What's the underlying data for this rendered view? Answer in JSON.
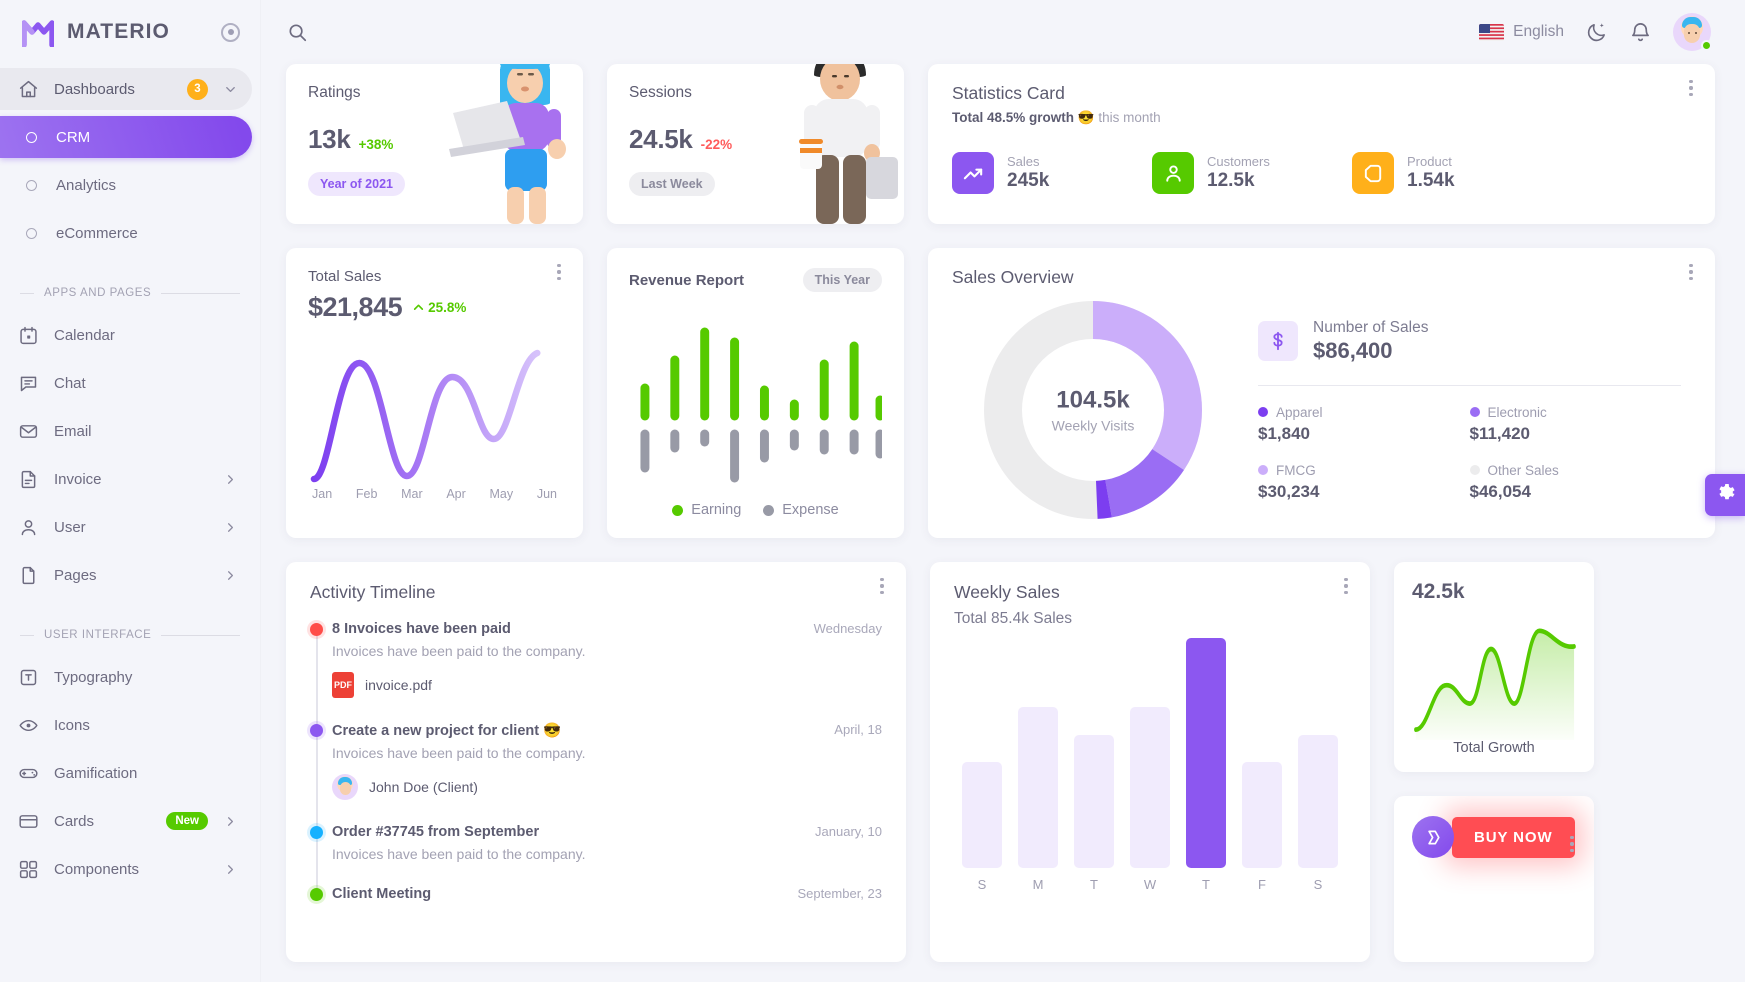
{
  "brand": {
    "name": "MATERIO",
    "logo_icon": "materio-logo-icon",
    "pin_icon": "pin-sidebar-icon"
  },
  "sidebar": {
    "group": {
      "label": "Dashboards",
      "badge": "3",
      "icon": "home-icon",
      "chevron": "chevron-down-icon"
    },
    "dashboards": [
      {
        "label": "CRM",
        "active": true
      },
      {
        "label": "Analytics",
        "active": false
      },
      {
        "label": "eCommerce",
        "active": false
      }
    ],
    "section_apps": "APPS AND PAGES",
    "apps": [
      {
        "label": "Calendar",
        "icon": "calendar-icon",
        "arrow": false,
        "badge": ""
      },
      {
        "label": "Chat",
        "icon": "chat-icon",
        "arrow": false,
        "badge": ""
      },
      {
        "label": "Email",
        "icon": "email-icon",
        "arrow": false,
        "badge": ""
      },
      {
        "label": "Invoice",
        "icon": "invoice-icon",
        "arrow": true,
        "badge": ""
      },
      {
        "label": "User",
        "icon": "user-icon",
        "arrow": true,
        "badge": ""
      },
      {
        "label": "Pages",
        "icon": "pages-icon",
        "arrow": true,
        "badge": ""
      }
    ],
    "section_ui": "USER INTERFACE",
    "ui": [
      {
        "label": "Typography",
        "icon": "typography-icon",
        "arrow": false,
        "badge": ""
      },
      {
        "label": "Icons",
        "icon": "eye-icon",
        "arrow": false,
        "badge": ""
      },
      {
        "label": "Gamification",
        "icon": "gamepad-icon",
        "arrow": false,
        "badge": ""
      },
      {
        "label": "Cards",
        "icon": "card-icon",
        "arrow": true,
        "badge": "New"
      },
      {
        "label": "Components",
        "icon": "components-icon",
        "arrow": true,
        "badge": ""
      }
    ]
  },
  "topbar": {
    "search_icon": "search-icon",
    "language": "English",
    "flag_icon": "us-flag-icon",
    "theme_icon": "moon-icon",
    "bell_icon": "bell-icon",
    "avatar_icon": "user-avatar"
  },
  "ratings": {
    "title": "Ratings",
    "value": "13k",
    "delta": "+38%",
    "chip": "Year of 2021",
    "art": "woman-with-laptop-illustration"
  },
  "sessions": {
    "title": "Sessions",
    "value": "24.5k",
    "delta": "-22%",
    "chip": "Last Week",
    "art": "man-with-coffee-illustration"
  },
  "statistics": {
    "title": "Statistics Card",
    "sub_strong": "Total 48.5% growth",
    "sub_emoji": "😎",
    "sub_rest": "this month",
    "items": [
      {
        "label": "Sales",
        "value": "245k",
        "color": "#8c57f0",
        "icon": "trending-up-icon"
      },
      {
        "label": "Customers",
        "value": "12.5k",
        "color": "#56ca00",
        "icon": "account-icon"
      },
      {
        "label": "Product",
        "value": "1.54k",
        "color": "#ffb01a",
        "icon": "tag-icon"
      }
    ]
  },
  "total_sales": {
    "title": "Total Sales",
    "value": "$21,845",
    "delta": "25.8%"
  },
  "revenue_report": {
    "title": "Revenue Report",
    "chip": "This Year",
    "legend": [
      {
        "label": "Earning",
        "color": "#56ca00"
      },
      {
        "label": "Expense",
        "color": "#989aa6"
      }
    ]
  },
  "sales_overview": {
    "title": "Sales Overview",
    "center_value": "104.5k",
    "center_caption": "Weekly Visits",
    "sales_label": "Number of Sales",
    "sales_value": "$86,400",
    "legend": [
      {
        "name": "Apparel",
        "value": "$1,840",
        "color": "#7c3ef0"
      },
      {
        "name": "Electronic",
        "value": "$11,420",
        "color": "#9a6df4"
      },
      {
        "name": "FMCG",
        "value": "$30,234",
        "color": "#cbaefa"
      },
      {
        "name": "Other Sales",
        "value": "$46,054",
        "color": "#ececed"
      }
    ]
  },
  "activity_timeline": {
    "title": "Activity Timeline",
    "items": [
      {
        "name": "8 Invoices have been paid",
        "date": "Wednesday",
        "desc": "Invoices have been paid to the company.",
        "color": "#ff4d49",
        "attachment": "invoice.pdf",
        "attachment_type": "pdf",
        "pdf_label": "PDF"
      },
      {
        "name": "Create a new project for client 😎",
        "date": "April, 18",
        "desc": "Invoices have been paid to the company.",
        "color": "#8c57f0",
        "attachment": "John Doe (Client)",
        "attachment_type": "avatar"
      },
      {
        "name": "Order #37745 from September",
        "date": "January, 10",
        "desc": "Invoices have been paid to the company.",
        "color": "#16b1ff",
        "attachment": "",
        "attachment_type": "none"
      },
      {
        "name": "Client Meeting",
        "date": "September, 23",
        "desc": "",
        "color": "#56ca00",
        "attachment": "",
        "attachment_type": "none"
      }
    ]
  },
  "weekly_sales": {
    "title": "Weekly Sales",
    "subtitle": "Total 85.4k Sales"
  },
  "total_growth": {
    "value": "42.5k",
    "caption": "Total Growth"
  },
  "promo": {
    "buy_now": "BUY NOW",
    "logo_icon": "themeselection-logo-icon"
  },
  "settings_tab": {
    "icon": "gear-icon"
  },
  "chart_data": [
    {
      "type": "line",
      "name": "total-sales-trend",
      "title": "Total Sales",
      "categories": [
        "Jan",
        "Feb",
        "Mar",
        "Apr",
        "May",
        "Jun"
      ],
      "values": [
        8,
        86,
        14,
        72,
        42,
        96
      ],
      "ylim": [
        0,
        100
      ],
      "grid": false,
      "legend": "none",
      "colors": [
        "#8c57f0"
      ]
    },
    {
      "type": "bar",
      "name": "revenue-report",
      "title": "Revenue Report",
      "categories": [
        "1",
        "2",
        "3",
        "4",
        "5",
        "6",
        "7",
        "8",
        "9"
      ],
      "series": [
        {
          "name": "Earning",
          "color": "#56ca00",
          "values": [
            28,
            48,
            72,
            64,
            24,
            12,
            44,
            60,
            16
          ]
        },
        {
          "name": "Expense",
          "color": "#989aa6",
          "values": [
            -34,
            -14,
            -8,
            -44,
            -22,
            -12,
            -16,
            -16,
            -18
          ]
        }
      ],
      "ylim": [
        -50,
        80
      ],
      "grid": false,
      "legend": "bottom"
    },
    {
      "type": "pie",
      "name": "sales-overview-donut",
      "title": "Sales Overview",
      "labels": [
        "Apparel",
        "Electronic",
        "FMCG",
        "Other Sales"
      ],
      "values": [
        1840,
        11420,
        30234,
        46054
      ],
      "colors": [
        "#7c3ef0",
        "#9a6df4",
        "#cbaefa",
        "#ececed"
      ],
      "center_label": "104.5k",
      "center_sublabel": "Weekly Visits",
      "legend": "right"
    },
    {
      "type": "bar",
      "name": "weekly-sales",
      "title": "Weekly Sales",
      "categories": [
        "S",
        "M",
        "T",
        "W",
        "T",
        "F",
        "S"
      ],
      "values": [
        46,
        70,
        58,
        70,
        100,
        46,
        58
      ],
      "highlight_index": 4,
      "ylim": [
        0,
        110
      ],
      "grid": false,
      "legend": "none",
      "colors": [
        "#f1ebfd",
        "#8c57f0"
      ]
    },
    {
      "type": "area",
      "name": "total-growth",
      "title": "Total Growth",
      "values": [
        6,
        38,
        26,
        62,
        30,
        86,
        74
      ],
      "ylim": [
        0,
        100
      ],
      "grid": false,
      "legend": "none",
      "colors": [
        "#56ca00"
      ]
    }
  ]
}
